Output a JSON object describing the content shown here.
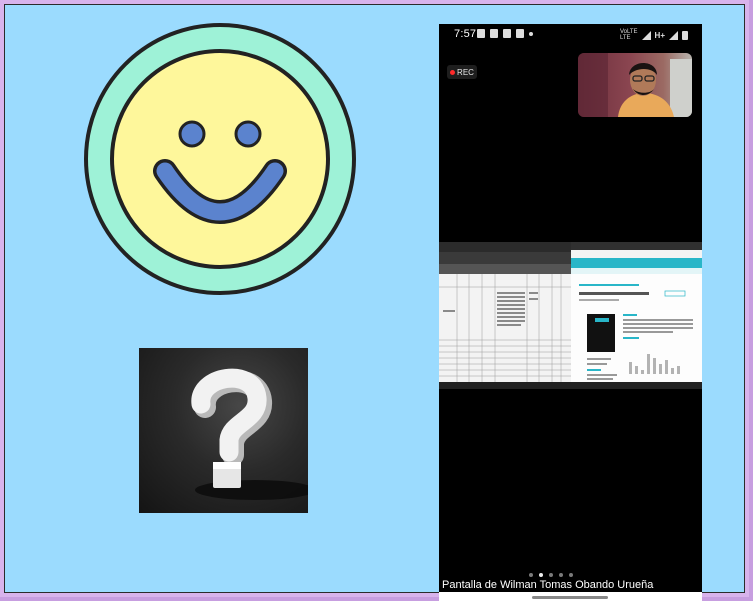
{
  "phone": {
    "time": "7:57",
    "volte_top": "VoLTE",
    "volte_bottom": "LTE",
    "network": "H+",
    "rec_label": "REC",
    "caption": "Pantalla de Wilman Tomas Obando Urueña",
    "page_dots": [
      false,
      true,
      false,
      false,
      false
    ]
  },
  "shared_screen": {
    "doc_title": "El pensamiento educativo de los trabajos",
    "section_heading": "Resumen",
    "subheading": "Descargas"
  },
  "colors": {
    "background": "#9bdbfe",
    "smiley_ring": "#9ef2d7",
    "smiley_face": "#fef79b",
    "smiley_features": "#5b83ce"
  }
}
